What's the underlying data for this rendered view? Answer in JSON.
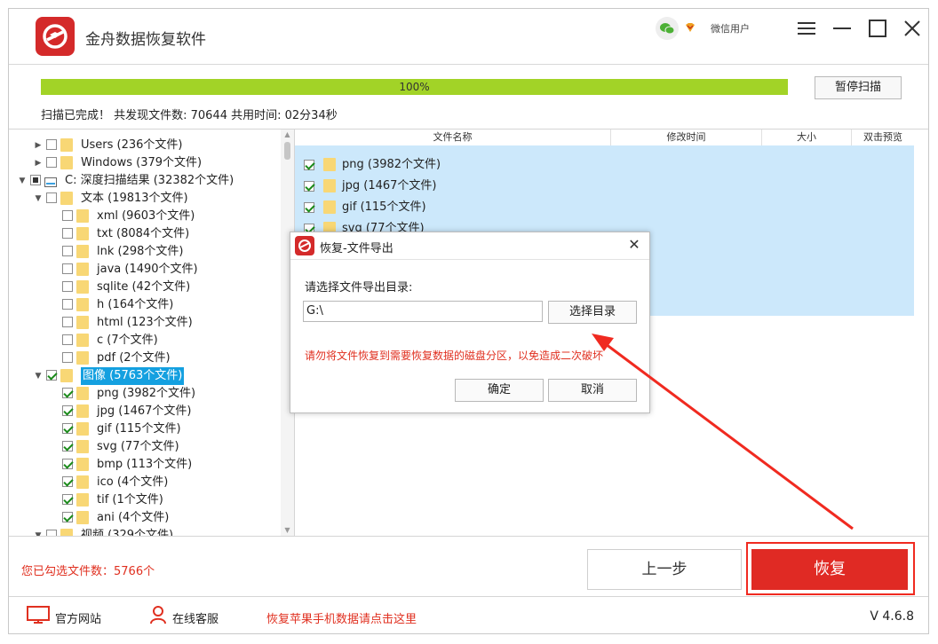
{
  "app": {
    "title": "金舟数据恢复软件",
    "user_name": "微信用户",
    "icons": {
      "wechat": "wechat-icon",
      "vip": "vip-diamond-icon",
      "menu": "menu-icon",
      "minimize": "minimize-icon",
      "maximize": "maximize-icon",
      "close": "close-icon"
    }
  },
  "scan": {
    "progress_percent": 100,
    "progress_label": "100%",
    "pause_label": "暂停扫描",
    "status_text": "扫描已完成！ 共发现文件数: 70644  共用时间: 02分34秒",
    "progress_color": "#a2d327"
  },
  "tree": {
    "rows": [
      {
        "label": "Users",
        "count": "(236个文件)",
        "checked": "none"
      },
      {
        "label": "Windows",
        "count": "(379个文件)",
        "checked": "none"
      },
      {
        "label": "C: 深度扫描结果",
        "count": "(32382个文件)",
        "checked": "partial"
      },
      {
        "label": "文本",
        "count": "(19813个文件)",
        "checked": "none"
      },
      {
        "label": "xml",
        "count": "(9603个文件)",
        "checked": "none"
      },
      {
        "label": "txt",
        "count": "(8084个文件)",
        "checked": "none"
      },
      {
        "label": "lnk",
        "count": "(298个文件)",
        "checked": "none"
      },
      {
        "label": "java",
        "count": "(1490个文件)",
        "checked": "none"
      },
      {
        "label": "sqlite",
        "count": "(42个文件)",
        "checked": "none"
      },
      {
        "label": "h",
        "count": "(164个文件)",
        "checked": "none"
      },
      {
        "label": "html",
        "count": "(123个文件)",
        "checked": "none"
      },
      {
        "label": "c",
        "count": "(7个文件)",
        "checked": "none"
      },
      {
        "label": "pdf",
        "count": "(2个文件)",
        "checked": "none"
      },
      {
        "label": "图像",
        "count": "(5763个文件)",
        "checked": "checked"
      },
      {
        "label": "png",
        "count": "(3982个文件)",
        "checked": "checked"
      },
      {
        "label": "jpg",
        "count": "(1467个文件)",
        "checked": "checked"
      },
      {
        "label": "gif",
        "count": "(115个文件)",
        "checked": "checked"
      },
      {
        "label": "svg",
        "count": "(77个文件)",
        "checked": "checked"
      },
      {
        "label": "bmp",
        "count": "(113个文件)",
        "checked": "checked"
      },
      {
        "label": "ico",
        "count": "(4个文件)",
        "checked": "checked"
      },
      {
        "label": "tif",
        "count": "(1个文件)",
        "checked": "checked"
      },
      {
        "label": "ani",
        "count": "(4个文件)",
        "checked": "checked"
      },
      {
        "label": "视频",
        "count": "(329个文件)",
        "checked": "none"
      }
    ]
  },
  "files": {
    "columns": [
      "文件名称",
      "修改时间",
      "大小",
      "双击预览"
    ],
    "rows": [
      {
        "name": "png",
        "count": "(3982个文件)"
      },
      {
        "name": "jpg",
        "count": "(1467个文件)"
      },
      {
        "name": "gif",
        "count": "(115个文件)"
      },
      {
        "name": "svg",
        "count": "(77个文件)"
      }
    ]
  },
  "dialog": {
    "title": "恢复-文件导出",
    "prompt": "请选择文件导出目录:",
    "path_value": "G:\\",
    "browse_label": "选择目录",
    "warning": "请勿将文件恢复到需要恢复数据的磁盘分区，以免造成二次破坏",
    "ok_label": "确定",
    "cancel_label": "取消"
  },
  "bottom": {
    "selected_count_text": "您已勾选文件数：5766个",
    "prev_label": "上一步",
    "recover_label": "恢复",
    "accent_color": "#e02a24"
  },
  "footer": {
    "website_label": "官方网站",
    "support_label": "在线客服",
    "iphone_link": "恢复苹果手机数据请点击这里",
    "version": "V 4.6.8"
  }
}
